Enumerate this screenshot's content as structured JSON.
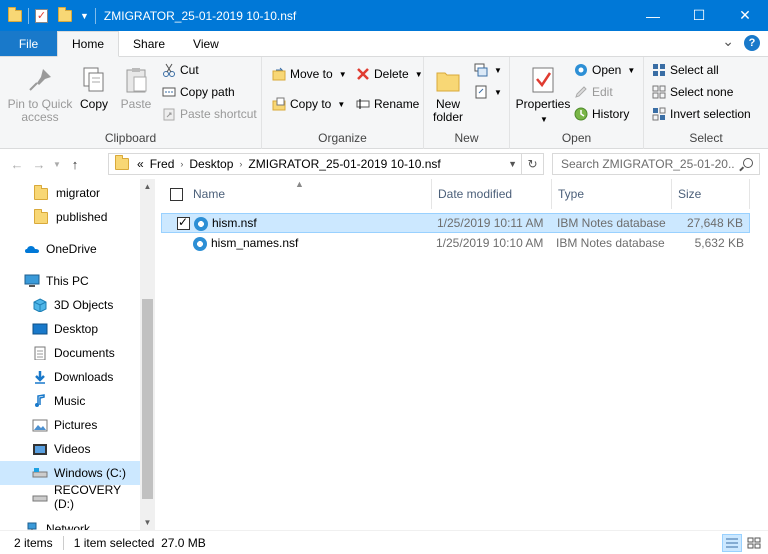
{
  "window": {
    "title": "ZMIGRATOR_25-01-2019 10-10.nsf",
    "minimize_glyph": "—",
    "maximize_glyph": "☐",
    "close_glyph": "✕"
  },
  "menu": {
    "file": "File",
    "tabs": [
      "Home",
      "Share",
      "View"
    ],
    "expand_glyph": "⌄",
    "help_glyph": "?"
  },
  "ribbon": {
    "clipboard": {
      "label": "Clipboard",
      "pin": "Pin to Quick access",
      "copy": "Copy",
      "paste": "Paste",
      "cut": "Cut",
      "copy_path": "Copy path",
      "paste_shortcut": "Paste shortcut"
    },
    "organize": {
      "label": "Organize",
      "move_to": "Move to",
      "copy_to": "Copy to",
      "delete": "Delete",
      "rename": "Rename"
    },
    "new": {
      "label": "New",
      "new_folder": "New folder"
    },
    "open": {
      "label": "Open",
      "properties": "Properties",
      "open": "Open",
      "edit": "Edit",
      "history": "History"
    },
    "select": {
      "label": "Select",
      "select_all": "Select all",
      "select_none": "Select none",
      "invert": "Invert selection"
    }
  },
  "address": {
    "overflow": "«",
    "crumbs": [
      "Fred",
      "Desktop",
      "ZMIGRATOR_25-01-2019 10-10.nsf"
    ],
    "search_placeholder": "Search ZMIGRATOR_25-01-20..."
  },
  "nav": {
    "items": [
      {
        "label": "migrator",
        "icon": "folder-icon"
      },
      {
        "label": "published",
        "icon": "folder-icon"
      },
      {
        "label": "OneDrive",
        "icon": "cloud-icon"
      },
      {
        "label": "This PC",
        "icon": "computer-icon"
      },
      {
        "label": "3D Objects",
        "icon": "cube-icon"
      },
      {
        "label": "Desktop",
        "icon": "desktop-icon"
      },
      {
        "label": "Documents",
        "icon": "document-icon"
      },
      {
        "label": "Downloads",
        "icon": "download-icon"
      },
      {
        "label": "Music",
        "icon": "music-icon"
      },
      {
        "label": "Pictures",
        "icon": "pictures-icon"
      },
      {
        "label": "Videos",
        "icon": "video-icon"
      },
      {
        "label": "Windows (C:)",
        "icon": "drive-icon"
      },
      {
        "label": "RECOVERY (D:)",
        "icon": "drive-icon"
      },
      {
        "label": "Network",
        "icon": "network-icon"
      }
    ]
  },
  "files": {
    "columns": [
      "Name",
      "Date modified",
      "Type",
      "Size"
    ],
    "rows": [
      {
        "name": "hism.nsf",
        "date": "1/25/2019 10:11 AM",
        "type": "IBM Notes database",
        "size": "27,648 KB",
        "selected": true
      },
      {
        "name": "hism_names.nsf",
        "date": "1/25/2019 10:10 AM",
        "type": "IBM Notes database",
        "size": "5,632 KB",
        "selected": false
      }
    ]
  },
  "status": {
    "count": "2 items",
    "selection": "1 item selected  27.0 MB"
  },
  "colors": {
    "accent": "#0078d7",
    "selection": "#cce8ff"
  }
}
